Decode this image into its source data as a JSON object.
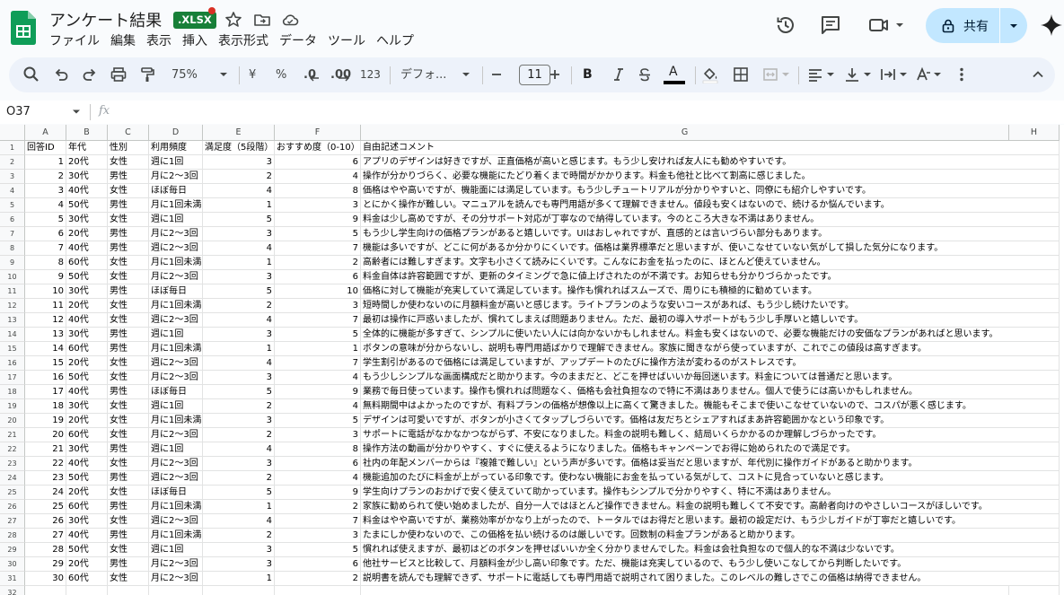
{
  "document": {
    "title": "アンケート結果",
    "format_badge": ".XLSX"
  },
  "menu": [
    "ファイル",
    "編集",
    "表示",
    "挿入",
    "表示形式",
    "データ",
    "ツール",
    "ヘルプ"
  ],
  "share": {
    "label": "共有"
  },
  "toolbar": {
    "zoom": "75%",
    "currency": "¥",
    "percent": "%",
    "decimal_decrease": ".0",
    "decimal_increase": ".00",
    "number_format": "123",
    "font": "デフォ...",
    "font_size": "11",
    "bold": "B",
    "text_color_glyph": "A"
  },
  "formula_bar": {
    "cell_ref": "O37",
    "fx": "fx"
  },
  "columns": [
    "A",
    "B",
    "C",
    "D",
    "E",
    "F",
    "G",
    "H"
  ],
  "header_row": [
    "回答ID",
    "年代",
    "性別",
    "利用頻度",
    "満足度（5段階）",
    "おすすめ度（0-10）",
    "自由記述コメント"
  ],
  "rows": [
    [
      "1",
      "20代",
      "女性",
      "週に1回",
      "3",
      "6",
      "アプリのデザインは好きですが、正直価格が高いと感じます。もう少し安ければ友人にも勧めやすいです。"
    ],
    [
      "2",
      "30代",
      "男性",
      "月に2〜3回",
      "2",
      "4",
      "操作が分かりづらく、必要な機能にたどり着くまで時間がかかります。料金も他社と比べて割高に感じました。"
    ],
    [
      "3",
      "40代",
      "女性",
      "ほぼ毎日",
      "4",
      "8",
      "価格はやや高いですが、機能面には満足しています。もう少しチュートリアルが分かりやすいと、同僚にも紹介しやすいです。"
    ],
    [
      "4",
      "50代",
      "男性",
      "月に1回未満",
      "1",
      "3",
      "とにかく操作が難しい。マニュアルを読んでも専門用語が多くて理解できません。値段も安くはないので、続けるか悩んでいます。"
    ],
    [
      "5",
      "30代",
      "女性",
      "週に1回",
      "5",
      "9",
      "料金は少し高めですが、その分サポート対応が丁寧なので納得しています。今のところ大きな不満はありません。"
    ],
    [
      "6",
      "20代",
      "男性",
      "月に2〜3回",
      "3",
      "5",
      "もう少し学生向けの価格プランがあると嬉しいです。UIはおしゃれですが、直感的とは言いづらい部分もあります。"
    ],
    [
      "7",
      "40代",
      "男性",
      "週に2〜3回",
      "4",
      "7",
      "機能は多いですが、どこに何があるか分かりにくいです。価格は業界標準だと思いますが、使いこなせていない気がして損した気分になります。"
    ],
    [
      "8",
      "60代",
      "女性",
      "月に1回未満",
      "1",
      "2",
      "高齢者には難しすぎます。文字も小さくて読みにくいです。こんなにお金を払ったのに、ほとんど使えていません。"
    ],
    [
      "9",
      "50代",
      "女性",
      "月に2〜3回",
      "3",
      "6",
      "料金自体は許容範囲ですが、更新のタイミングで急に値上げされたのが不満です。お知らせも分かりづらかったです。"
    ],
    [
      "10",
      "30代",
      "男性",
      "ほぼ毎日",
      "5",
      "10",
      "価格に対して機能が充実していて満足しています。操作も慣れればスムーズで、周りにも積極的に勧めています。"
    ],
    [
      "11",
      "20代",
      "女性",
      "月に1回未満",
      "2",
      "3",
      "短時間しか使わないのに月額料金が高いと感じます。ライトプランのような安いコースがあれば、もう少し続けたいです。"
    ],
    [
      "12",
      "40代",
      "女性",
      "週に2〜3回",
      "4",
      "7",
      "最初は操作に戸惑いましたが、慣れてしまえば問題ありません。ただ、最初の導入サポートがもう少し手厚いと嬉しいです。"
    ],
    [
      "13",
      "30代",
      "男性",
      "週に1回",
      "3",
      "5",
      "全体的に機能が多すぎて、シンプルに使いたい人には向かないかもしれません。料金も安くはないので、必要な機能だけの安価なプランがあればと思います。"
    ],
    [
      "14",
      "60代",
      "男性",
      "月に1回未満",
      "1",
      "1",
      "ボタンの意味が分からないし、説明も専門用語ばかりで理解できません。家族に聞きながら使っていますが、これでこの値段は高すぎます。"
    ],
    [
      "15",
      "20代",
      "女性",
      "週に2〜3回",
      "4",
      "7",
      "学生割引があるので価格には満足していますが、アップデートのたびに操作方法が変わるのがストレスです。"
    ],
    [
      "16",
      "50代",
      "女性",
      "月に2〜3回",
      "3",
      "4",
      "もう少しシンプルな画面構成だと助かります。今のままだと、どこを押せばいいか毎回迷います。料金については普通だと思います。"
    ],
    [
      "17",
      "40代",
      "男性",
      "ほぼ毎日",
      "5",
      "9",
      "業務で毎日使っています。操作も慣れれば問題なく、価格も会社負担なので特に不満はありません。個人で使うには高いかもしれません。"
    ],
    [
      "18",
      "30代",
      "女性",
      "週に1回",
      "2",
      "4",
      "無料期間中はよかったのですが、有料プランの価格が想像以上に高くて驚きました。機能もそこまで使いこなせていないので、コスパが悪く感じます。"
    ],
    [
      "19",
      "20代",
      "女性",
      "月に1回未満",
      "3",
      "5",
      "デザインは可愛いですが、ボタンが小さくてタップしづらいです。価格は友だちとシェアすればまあ許容範囲かなという印象です。"
    ],
    [
      "20",
      "60代",
      "女性",
      "月に2〜3回",
      "2",
      "3",
      "サポートに電話がなかなかつながらず、不安になりました。料金の説明も難しく、結局いくらかかるのか理解しづらかったです。"
    ],
    [
      "21",
      "30代",
      "男性",
      "週に1回",
      "4",
      "8",
      "操作方法の動画が分かりやすく、すぐに使えるようになりました。価格もキャンペーンでお得に始められたので満足です。"
    ],
    [
      "22",
      "40代",
      "女性",
      "月に2〜3回",
      "3",
      "6",
      "社内の年配メンバーからは『複雑で難しい』という声が多いです。価格は妥当だと思いますが、年代別に操作ガイドがあると助かります。"
    ],
    [
      "23",
      "50代",
      "男性",
      "週に2〜3回",
      "2",
      "4",
      "機能追加のたびに料金が上がっている印象です。使わない機能にお金を払っている気がして、コストに見合っていないと感じます。"
    ],
    [
      "24",
      "20代",
      "女性",
      "ほぼ毎日",
      "5",
      "9",
      "学生向けプランのおかげで安く使えていて助かっています。操作もシンプルで分かりやすく、特に不満はありません。"
    ],
    [
      "25",
      "60代",
      "男性",
      "月に1回未満",
      "1",
      "2",
      "家族に勧められて使い始めましたが、自分一人ではほとんど操作できません。料金の説明も難しくて不安です。高齢者向けのやさしいコースがほしいです。"
    ],
    [
      "26",
      "30代",
      "女性",
      "週に2〜3回",
      "4",
      "7",
      "料金はやや高いですが、業務効率がかなり上がったので、トータルではお得だと思います。最初の設定だけ、もう少しガイドが丁寧だと嬉しいです。"
    ],
    [
      "27",
      "40代",
      "男性",
      "月に1回未満",
      "2",
      "3",
      "たまにしか使わないので、この価格を払い続けるのは厳しいです。回数制の料金プランがあると助かります。"
    ],
    [
      "28",
      "50代",
      "女性",
      "週に1回",
      "3",
      "5",
      "慣れれば使えますが、最初はどのボタンを押せばいいか全く分かりませんでした。料金は会社負担なので個人的な不満は少ないです。"
    ],
    [
      "29",
      "20代",
      "男性",
      "月に2〜3回",
      "3",
      "6",
      "他社サービスと比較して、月額料金が少し高い印象です。ただ、機能は充実しているので、もう少し使いこなしてから判断したいです。"
    ],
    [
      "30",
      "60代",
      "女性",
      "月に2〜3回",
      "1",
      "2",
      "説明書を読んでも理解できず、サポートに電話しても専門用語で説明されて困りました。このレベルの難しさでこの価格は納得できません。"
    ]
  ]
}
